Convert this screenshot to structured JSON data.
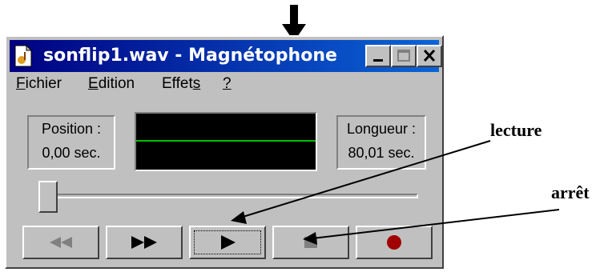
{
  "window": {
    "title": "sonflip1.wav - Magnétophone",
    "menu": [
      {
        "underlined": "F",
        "rest": "ichier"
      },
      {
        "underlined": "E",
        "rest": "dition"
      },
      {
        "prefix": "Effet",
        "underlined": "s",
        "rest": ""
      },
      {
        "underlined": "?",
        "rest": ""
      }
    ],
    "position": {
      "label": "Position :",
      "value": "0,00 sec."
    },
    "length": {
      "label": "Longueur :",
      "value": "80,01 sec."
    },
    "slider_fraction": 0.0,
    "controls": [
      "rewind-icon",
      "fast-forward-icon",
      "play-icon",
      "stop-icon",
      "record-icon"
    ]
  },
  "annotations": {
    "play": "lecture",
    "stop": "arrêt"
  },
  "colors": {
    "title_start": "#000080",
    "title_end": "#0a64d8",
    "waveform": "#00c000",
    "record": "#a00000"
  }
}
